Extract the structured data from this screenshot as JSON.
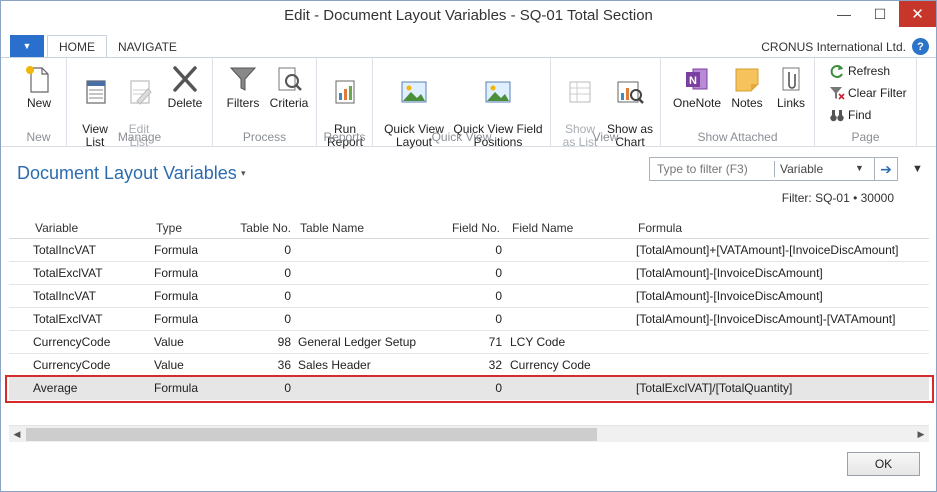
{
  "window": {
    "title": "Edit - Document Layout Variables - SQ-01 Total Section",
    "minimize_glyph": "—",
    "maximize_glyph": "☐",
    "close_glyph": "✕"
  },
  "ribbon_tabs": {
    "app_menu_glyph": "▼",
    "tabs": [
      {
        "label": "HOME"
      },
      {
        "label": "NAVIGATE"
      }
    ],
    "company": "CRONUS International Ltd.",
    "help_glyph": "?"
  },
  "ribbon": {
    "groups": {
      "new": {
        "label": "New",
        "buttons": [
          {
            "label": "New"
          }
        ]
      },
      "manage": {
        "label": "Manage",
        "buttons": [
          {
            "label": "View\nList"
          },
          {
            "label": "Edit\nList"
          },
          {
            "label": "Delete"
          }
        ]
      },
      "process": {
        "label": "Process",
        "buttons": [
          {
            "label": "Filters"
          },
          {
            "label": "Criteria"
          }
        ]
      },
      "reports": {
        "label": "Reports",
        "buttons": [
          {
            "label": "Run\nReport"
          }
        ]
      },
      "quick_view": {
        "label": "Quick View",
        "buttons": [
          {
            "label": "Quick View\nLayout"
          },
          {
            "label": "Quick View Field\nPositions"
          }
        ]
      },
      "view": {
        "label": "View",
        "buttons": [
          {
            "label": "Show\nas List"
          },
          {
            "label": "Show as\nChart"
          }
        ]
      },
      "show_attached": {
        "label": "Show Attached",
        "buttons": [
          {
            "label": "OneNote"
          },
          {
            "label": "Notes"
          },
          {
            "label": "Links"
          }
        ]
      },
      "page": {
        "label": "Page",
        "buttons": [
          {
            "label": "Refresh"
          },
          {
            "label": "Clear Filter"
          },
          {
            "label": "Find"
          }
        ]
      }
    }
  },
  "page": {
    "title": "Document Layout Variables",
    "title_caret": "▾",
    "filter": {
      "placeholder": "Type to filter (F3)",
      "field": "Variable",
      "dropdown_glyph": "▼",
      "go_glyph": "➔"
    },
    "collapse_glyph": "▼",
    "filter_status": "Filter: SQ-01 • 30000"
  },
  "table": {
    "columns": [
      "Variable",
      "Type",
      "Table No.",
      "Table Name",
      "Field No.",
      "Field Name",
      "Formula"
    ],
    "rows": [
      {
        "variable": "TotalIncVAT",
        "type": "Formula",
        "table_no": "0",
        "table_name": "",
        "field_no": "0",
        "field_name": "",
        "formula": "[TotalAmount]+[VATAmount]-[InvoiceDiscAmount]"
      },
      {
        "variable": "TotalExclVAT",
        "type": "Formula",
        "table_no": "0",
        "table_name": "",
        "field_no": "0",
        "field_name": "",
        "formula": "[TotalAmount]-[InvoiceDiscAmount]"
      },
      {
        "variable": "TotalIncVAT",
        "type": "Formula",
        "table_no": "0",
        "table_name": "",
        "field_no": "0",
        "field_name": "",
        "formula": "[TotalAmount]-[InvoiceDiscAmount]"
      },
      {
        "variable": "TotalExclVAT",
        "type": "Formula",
        "table_no": "0",
        "table_name": "",
        "field_no": "0",
        "field_name": "",
        "formula": "[TotalAmount]-[InvoiceDiscAmount]-[VATAmount]"
      },
      {
        "variable": "CurrencyCode",
        "type": "Value",
        "table_no": "98",
        "table_name": "General Ledger Setup",
        "field_no": "71",
        "field_name": "LCY Code",
        "formula": ""
      },
      {
        "variable": "CurrencyCode",
        "type": "Value",
        "table_no": "36",
        "table_name": "Sales Header",
        "field_no": "32",
        "field_name": "Currency Code",
        "formula": ""
      },
      {
        "variable": "Average",
        "type": "Formula",
        "table_no": "0",
        "table_name": "",
        "field_no": "0",
        "field_name": "",
        "formula": "[TotalExclVAT]/[TotalQuantity]"
      }
    ]
  },
  "scrollbar": {
    "left_glyph": "◀",
    "right_glyph": "▶"
  },
  "footer": {
    "ok_label": "OK"
  },
  "colors": {
    "accent": "#2b6cb0",
    "selection_outline": "#d62b2b",
    "close_button": "#c7362b"
  }
}
